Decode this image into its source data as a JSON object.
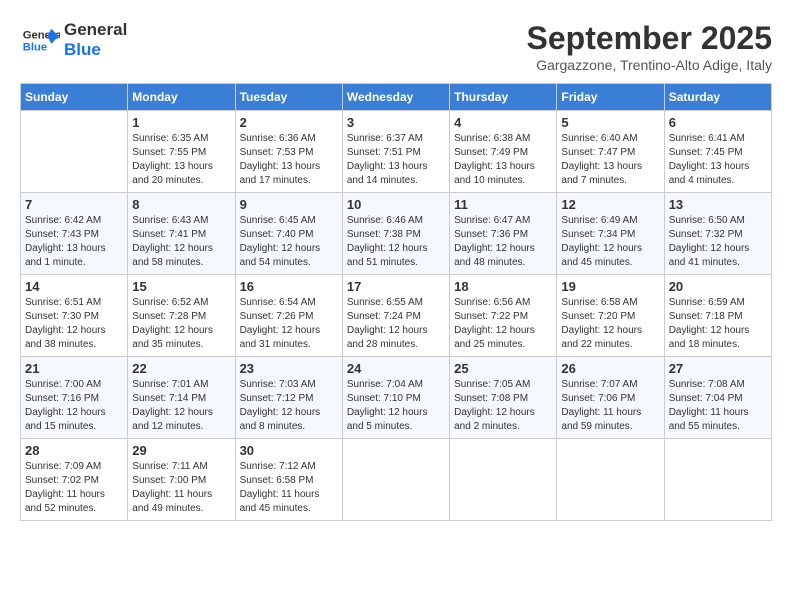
{
  "header": {
    "logo_line1": "General",
    "logo_line2": "Blue",
    "month_title": "September 2025",
    "subtitle": "Gargazzone, Trentino-Alto Adige, Italy"
  },
  "weekdays": [
    "Sunday",
    "Monday",
    "Tuesday",
    "Wednesday",
    "Thursday",
    "Friday",
    "Saturday"
  ],
  "weeks": [
    [
      {
        "day": "",
        "info": ""
      },
      {
        "day": "1",
        "info": "Sunrise: 6:35 AM\nSunset: 7:55 PM\nDaylight: 13 hours\nand 20 minutes."
      },
      {
        "day": "2",
        "info": "Sunrise: 6:36 AM\nSunset: 7:53 PM\nDaylight: 13 hours\nand 17 minutes."
      },
      {
        "day": "3",
        "info": "Sunrise: 6:37 AM\nSunset: 7:51 PM\nDaylight: 13 hours\nand 14 minutes."
      },
      {
        "day": "4",
        "info": "Sunrise: 6:38 AM\nSunset: 7:49 PM\nDaylight: 13 hours\nand 10 minutes."
      },
      {
        "day": "5",
        "info": "Sunrise: 6:40 AM\nSunset: 7:47 PM\nDaylight: 13 hours\nand 7 minutes."
      },
      {
        "day": "6",
        "info": "Sunrise: 6:41 AM\nSunset: 7:45 PM\nDaylight: 13 hours\nand 4 minutes."
      }
    ],
    [
      {
        "day": "7",
        "info": "Sunrise: 6:42 AM\nSunset: 7:43 PM\nDaylight: 13 hours\nand 1 minute."
      },
      {
        "day": "8",
        "info": "Sunrise: 6:43 AM\nSunset: 7:41 PM\nDaylight: 12 hours\nand 58 minutes."
      },
      {
        "day": "9",
        "info": "Sunrise: 6:45 AM\nSunset: 7:40 PM\nDaylight: 12 hours\nand 54 minutes."
      },
      {
        "day": "10",
        "info": "Sunrise: 6:46 AM\nSunset: 7:38 PM\nDaylight: 12 hours\nand 51 minutes."
      },
      {
        "day": "11",
        "info": "Sunrise: 6:47 AM\nSunset: 7:36 PM\nDaylight: 12 hours\nand 48 minutes."
      },
      {
        "day": "12",
        "info": "Sunrise: 6:49 AM\nSunset: 7:34 PM\nDaylight: 12 hours\nand 45 minutes."
      },
      {
        "day": "13",
        "info": "Sunrise: 6:50 AM\nSunset: 7:32 PM\nDaylight: 12 hours\nand 41 minutes."
      }
    ],
    [
      {
        "day": "14",
        "info": "Sunrise: 6:51 AM\nSunset: 7:30 PM\nDaylight: 12 hours\nand 38 minutes."
      },
      {
        "day": "15",
        "info": "Sunrise: 6:52 AM\nSunset: 7:28 PM\nDaylight: 12 hours\nand 35 minutes."
      },
      {
        "day": "16",
        "info": "Sunrise: 6:54 AM\nSunset: 7:26 PM\nDaylight: 12 hours\nand 31 minutes."
      },
      {
        "day": "17",
        "info": "Sunrise: 6:55 AM\nSunset: 7:24 PM\nDaylight: 12 hours\nand 28 minutes."
      },
      {
        "day": "18",
        "info": "Sunrise: 6:56 AM\nSunset: 7:22 PM\nDaylight: 12 hours\nand 25 minutes."
      },
      {
        "day": "19",
        "info": "Sunrise: 6:58 AM\nSunset: 7:20 PM\nDaylight: 12 hours\nand 22 minutes."
      },
      {
        "day": "20",
        "info": "Sunrise: 6:59 AM\nSunset: 7:18 PM\nDaylight: 12 hours\nand 18 minutes."
      }
    ],
    [
      {
        "day": "21",
        "info": "Sunrise: 7:00 AM\nSunset: 7:16 PM\nDaylight: 12 hours\nand 15 minutes."
      },
      {
        "day": "22",
        "info": "Sunrise: 7:01 AM\nSunset: 7:14 PM\nDaylight: 12 hours\nand 12 minutes."
      },
      {
        "day": "23",
        "info": "Sunrise: 7:03 AM\nSunset: 7:12 PM\nDaylight: 12 hours\nand 8 minutes."
      },
      {
        "day": "24",
        "info": "Sunrise: 7:04 AM\nSunset: 7:10 PM\nDaylight: 12 hours\nand 5 minutes."
      },
      {
        "day": "25",
        "info": "Sunrise: 7:05 AM\nSunset: 7:08 PM\nDaylight: 12 hours\nand 2 minutes."
      },
      {
        "day": "26",
        "info": "Sunrise: 7:07 AM\nSunset: 7:06 PM\nDaylight: 11 hours\nand 59 minutes."
      },
      {
        "day": "27",
        "info": "Sunrise: 7:08 AM\nSunset: 7:04 PM\nDaylight: 11 hours\nand 55 minutes."
      }
    ],
    [
      {
        "day": "28",
        "info": "Sunrise: 7:09 AM\nSunset: 7:02 PM\nDaylight: 11 hours\nand 52 minutes."
      },
      {
        "day": "29",
        "info": "Sunrise: 7:11 AM\nSunset: 7:00 PM\nDaylight: 11 hours\nand 49 minutes."
      },
      {
        "day": "30",
        "info": "Sunrise: 7:12 AM\nSunset: 6:58 PM\nDaylight: 11 hours\nand 45 minutes."
      },
      {
        "day": "",
        "info": ""
      },
      {
        "day": "",
        "info": ""
      },
      {
        "day": "",
        "info": ""
      },
      {
        "day": "",
        "info": ""
      }
    ]
  ]
}
